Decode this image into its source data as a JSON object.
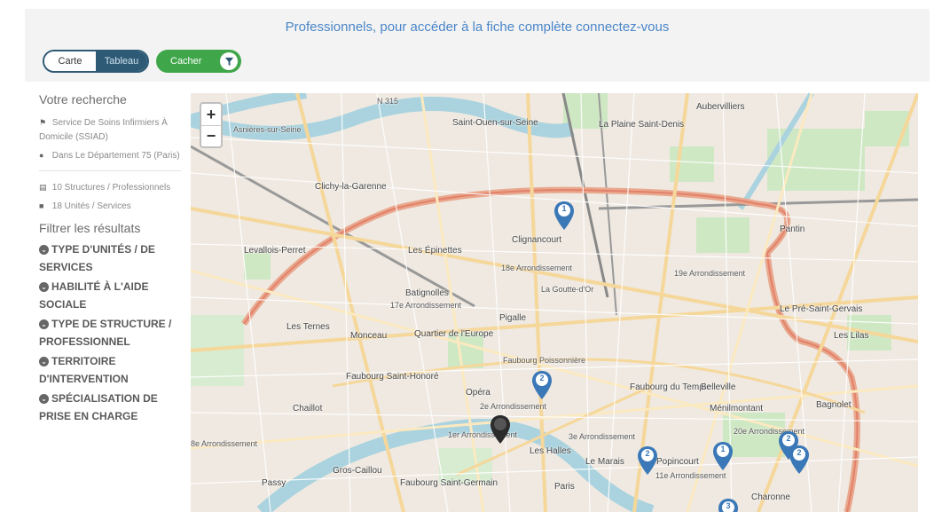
{
  "banner": {
    "text": "Professionnels, pour accéder à la fiche complète connectez-vous"
  },
  "view_toggle": {
    "carte": "Carte",
    "tableau": "Tableau"
  },
  "hide_button": {
    "label": "Cacher",
    "icon": "filter-icon"
  },
  "sidebar": {
    "title": "Votre recherche",
    "criteria": [
      {
        "icon": "tag-icon",
        "text": "Service De Soins Infirmiers À Domicile (SSIAD)"
      },
      {
        "icon": "location-pin-icon",
        "text": "Dans Le Département 75 (Paris)"
      }
    ],
    "counts": [
      {
        "icon": "building-icon",
        "text": "10 Structures / Professionnels"
      },
      {
        "icon": "id-card-icon",
        "text": "18 Unités / Services"
      }
    ],
    "filter_title": "Filtrer les résultats",
    "facets": [
      "TYPE D'UNITÉS / DE SERVICES",
      "HABILITÉ À L'AIDE SOCIALE",
      "TYPE DE STRUCTURE / PROFESSIONNEL",
      "TERRITOIRE D'INTERVENTION",
      "SPÉCIALISATION DE PRISE EN CHARGE"
    ]
  },
  "map": {
    "zoom_in": "+",
    "zoom_out": "−",
    "labels": {
      "asnieres": "Asnières-sur-Seine",
      "saint_ouen": "Saint-Ouen-sur-Seine",
      "plaine": "La Plaine Saint-Denis",
      "aubervilliers": "Aubervilliers",
      "clichy": "Clichy-la-Garenne",
      "levallois": "Levallois-Perret",
      "epinettes": "Les Épinettes",
      "clignancourt": "Clignancourt",
      "arr18": "18e Arrondissement",
      "arr19": "19e Arrondissement",
      "pantin": "Pantin",
      "batignolles": "Batignolles",
      "arr17": "17e Arrondissement",
      "goutte": "La Goutte-d'Or",
      "pre": "Le Pré-Saint-Gervais",
      "lilas": "Les Lilas",
      "ternes": "Les Ternes",
      "monceau": "Monceau",
      "europe": "Quartier de l'Europe",
      "pigalle": "Pigalle",
      "poissonniere": "Faubourg Poissonnière",
      "st_honore": "Faubourg Saint-Honoré",
      "opera": "Opéra",
      "temple": "Faubourg du Temple",
      "belleville": "Belleville",
      "chaillot": "Chaillot",
      "arr2": "2e Arrondissement",
      "menilmontant": "Ménilmontant",
      "bagnolet": "Bagnolet",
      "arr1": "1er Arrondissement",
      "arr3": "3e Arrondissement",
      "arr20": "20e Arrondissement",
      "halles": "Les Halles",
      "marais": "Le Marais",
      "popincourt": "Popincourt",
      "arr11": "11e Arrondissement",
      "passy": "Passy",
      "gros_caillou": "Gros-Caillou",
      "st_germain": "Faubourg Saint-Germain",
      "charonne": "Charonne",
      "n315": "N 315",
      "arr8": "8e Arrondissement",
      "paris": "Paris"
    },
    "markers": [
      {
        "name": "marker-clignancourt",
        "count": "1",
        "color": "#3b78b8"
      },
      {
        "name": "marker-opera",
        "count": "2",
        "color": "#3b78b8"
      },
      {
        "name": "marker-selected",
        "count": "",
        "color": "#2b2b2b"
      },
      {
        "name": "marker-marais",
        "count": "2",
        "color": "#3b78b8"
      },
      {
        "name": "marker-popincourt",
        "count": "1",
        "color": "#3b78b8"
      },
      {
        "name": "marker-20e-a",
        "count": "2",
        "color": "#3b78b8"
      },
      {
        "name": "marker-20e-b",
        "count": "2",
        "color": "#3b78b8"
      },
      {
        "name": "marker-charonne",
        "count": "3",
        "color": "#3b78b8"
      }
    ]
  },
  "colors": {
    "accent_blue": "#4a86c8",
    "toggle_dark": "#2e5a75",
    "green": "#3fa64a",
    "marker_blue": "#3b78b8"
  }
}
